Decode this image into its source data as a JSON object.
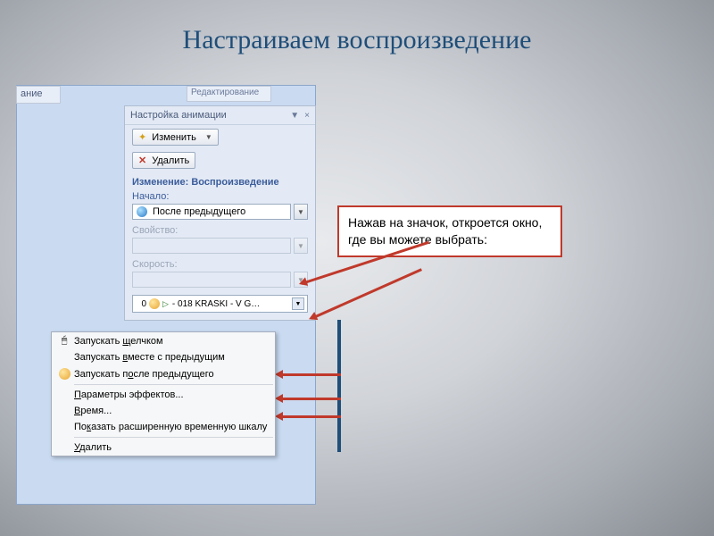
{
  "title": "Настраиваем воспроизведение",
  "tabs": {
    "edge": "ание",
    "edit": "Редактирование"
  },
  "panel": {
    "header": "Настройка анимации",
    "btn_change": "Изменить",
    "btn_delete": "Удалить",
    "section": "Изменение: Воспроизведение",
    "lbl_start": "Начало:",
    "val_start": "После предыдущего",
    "lbl_prop": "Свойство:",
    "lbl_speed": "Скорость:",
    "item_num": "0",
    "item_text": "- 018 KRASKI - V G…"
  },
  "ctx": {
    "i1": {
      "pre": "Запускать ",
      "u": "щ",
      "post": "елчком"
    },
    "i2": {
      "pre": "Запускать ",
      "u": "в",
      "post": "месте с предыдущим"
    },
    "i3": {
      "pre": "Запускать п",
      "u": "о",
      "post": "сле предыдущего"
    },
    "i4": {
      "u": "П",
      "post": "араметры эффектов..."
    },
    "i5": {
      "u": "В",
      "post": "ремя..."
    },
    "i6": {
      "pre": "По",
      "u": "к",
      "post": "азать расширенную временную шкалу"
    },
    "i7": {
      "u": "У",
      "post": "далить"
    }
  },
  "note": "Нажав на значок, откроется окно, где вы можете выбрать:"
}
